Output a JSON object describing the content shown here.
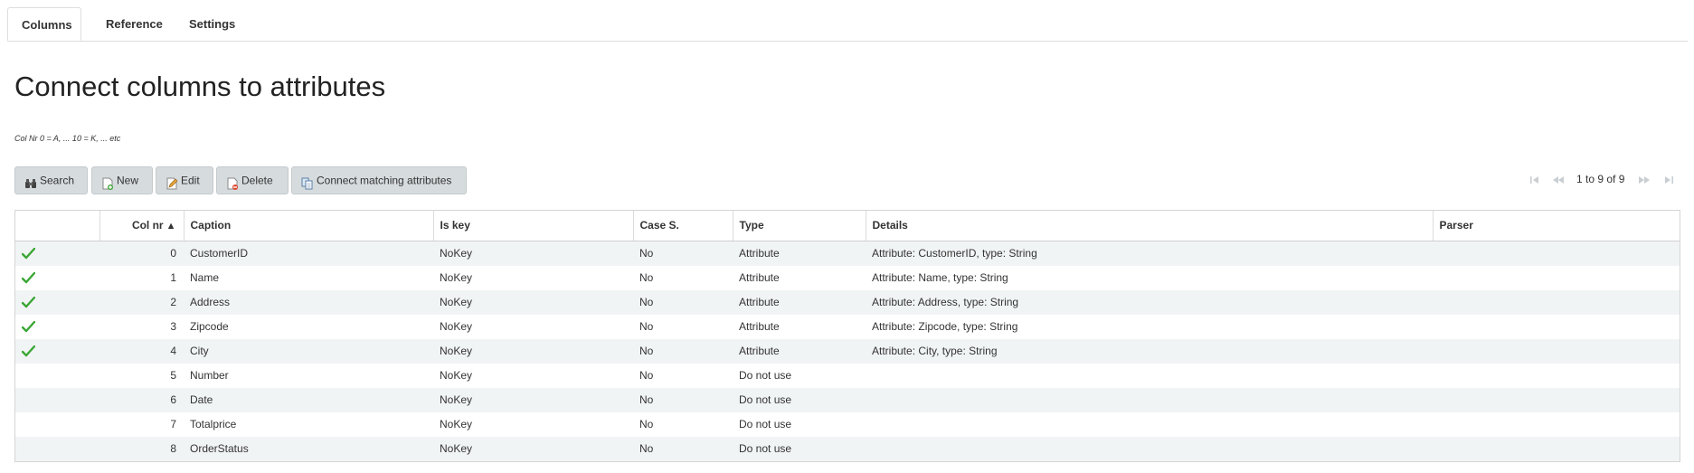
{
  "tabs": [
    {
      "label": "Columns",
      "active": true
    },
    {
      "label": "Reference",
      "active": false
    },
    {
      "label": "Settings",
      "active": false
    }
  ],
  "page_title": "Connect columns to attributes",
  "hint": "Col Nr 0 = A, ... 10 = K, ... etc",
  "toolbar": {
    "search_label": "Search",
    "new_label": "New",
    "edit_label": "Edit",
    "delete_label": "Delete",
    "connect_label": "Connect matching attributes"
  },
  "pager": {
    "info": "1 to 9 of 9",
    "icons": [
      "first-page-icon",
      "previous-page-icon",
      "next-page-icon",
      "last-page-icon"
    ]
  },
  "table": {
    "columns": [
      "",
      "Col nr",
      "Caption",
      "Is key",
      "Case S.",
      "Type",
      "Details",
      "Parser"
    ],
    "sort_indicator": "▲",
    "rows": [
      {
        "connected": true,
        "col_nr": "0",
        "caption": "CustomerID",
        "is_key": "NoKey",
        "case_s": "No",
        "type": "Attribute",
        "details": "Attribute: CustomerID, type: String",
        "parser": ""
      },
      {
        "connected": true,
        "col_nr": "1",
        "caption": "Name",
        "is_key": "NoKey",
        "case_s": "No",
        "type": "Attribute",
        "details": "Attribute: Name, type: String",
        "parser": ""
      },
      {
        "connected": true,
        "col_nr": "2",
        "caption": "Address",
        "is_key": "NoKey",
        "case_s": "No",
        "type": "Attribute",
        "details": "Attribute: Address, type: String",
        "parser": ""
      },
      {
        "connected": true,
        "col_nr": "3",
        "caption": "Zipcode",
        "is_key": "NoKey",
        "case_s": "No",
        "type": "Attribute",
        "details": "Attribute: Zipcode, type: String",
        "parser": ""
      },
      {
        "connected": true,
        "col_nr": "4",
        "caption": "City",
        "is_key": "NoKey",
        "case_s": "No",
        "type": "Attribute",
        "details": "Attribute: City, type: String",
        "parser": ""
      },
      {
        "connected": false,
        "col_nr": "5",
        "caption": "Number",
        "is_key": "NoKey",
        "case_s": "No",
        "type": "Do not use",
        "details": "",
        "parser": ""
      },
      {
        "connected": false,
        "col_nr": "6",
        "caption": "Date",
        "is_key": "NoKey",
        "case_s": "No",
        "type": "Do not use",
        "details": "",
        "parser": ""
      },
      {
        "connected": false,
        "col_nr": "7",
        "caption": "Totalprice",
        "is_key": "NoKey",
        "case_s": "No",
        "type": "Do not use",
        "details": "",
        "parser": ""
      },
      {
        "connected": false,
        "col_nr": "8",
        "caption": "OrderStatus",
        "is_key": "NoKey",
        "case_s": "No",
        "type": "Do not use",
        "details": "",
        "parser": ""
      }
    ]
  },
  "colors": {
    "button_bg": "#d6dbde",
    "row_stripe": "#f1f4f5",
    "check_green": "#3aa635",
    "border": "#d5d5d5"
  }
}
